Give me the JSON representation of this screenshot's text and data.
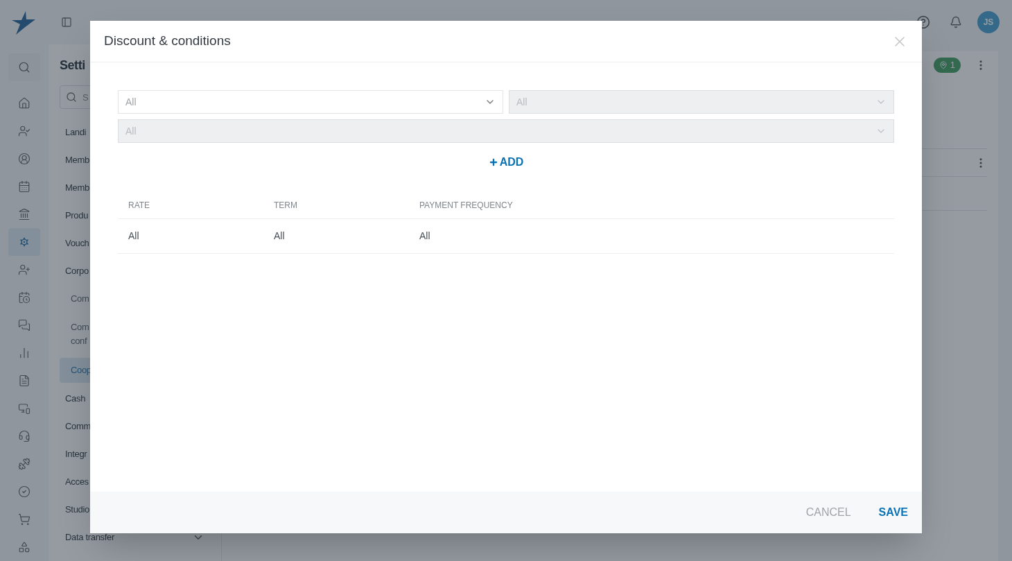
{
  "topbar": {
    "avatar": "JS"
  },
  "rail": [
    {
      "selected": false
    },
    {
      "selected": false
    },
    {
      "selected": false
    },
    {
      "selected": false
    },
    {
      "selected": false
    },
    {
      "selected": false
    },
    {
      "selected": true
    },
    {
      "selected": false
    },
    {
      "selected": false
    },
    {
      "selected": false
    },
    {
      "selected": false
    },
    {
      "selected": false
    },
    {
      "selected": false
    },
    {
      "selected": false
    },
    {
      "selected": false
    },
    {
      "selected": false
    },
    {
      "selected": false
    },
    {
      "selected": false
    }
  ],
  "settings_nav": {
    "title": "Setti",
    "search": {
      "placeholder": "S"
    },
    "items": [
      {
        "label": "Landi",
        "selected": false
      },
      {
        "label": "Memb",
        "selected": false
      },
      {
        "label": "Memb",
        "selected": false
      },
      {
        "label": "Produ",
        "selected": false
      },
      {
        "label": "Vouch",
        "selected": false
      },
      {
        "label": "Corpo",
        "selected": false,
        "children": [
          {
            "label": "Com",
            "selected": false
          },
          {
            "label": "Com conf",
            "selected": false
          },
          {
            "label": "Coop",
            "selected": true
          }
        ]
      },
      {
        "label": "Cash",
        "selected": false
      },
      {
        "label": "Comm",
        "selected": false
      },
      {
        "label": "Integr",
        "selected": false
      },
      {
        "label": "Acces",
        "selected": false
      },
      {
        "label": "Studio",
        "selected": false
      },
      {
        "label": "Data transfer",
        "selected": false,
        "kind": "group"
      }
    ]
  },
  "main": {
    "badge": "1",
    "rows": [
      {
        "kind": "row"
      },
      {
        "kind": "row"
      }
    ]
  },
  "dialog": {
    "title": "Discount & conditions",
    "selects": [
      {
        "value": "All",
        "disabled": false
      },
      {
        "value": "All",
        "disabled": true
      },
      {
        "value": "All",
        "disabled": true
      }
    ],
    "add_button": {
      "label": "ADD"
    },
    "table": {
      "columns": [
        "RATE",
        "TERM",
        "PAYMENT FREQUENCY"
      ],
      "rows": [
        [
          "All",
          "All",
          "All"
        ]
      ]
    },
    "buttons": [
      {
        "label": "CANCEL",
        "kind": "secondary"
      },
      {
        "label": "SAVE",
        "kind": "primary"
      }
    ]
  }
}
